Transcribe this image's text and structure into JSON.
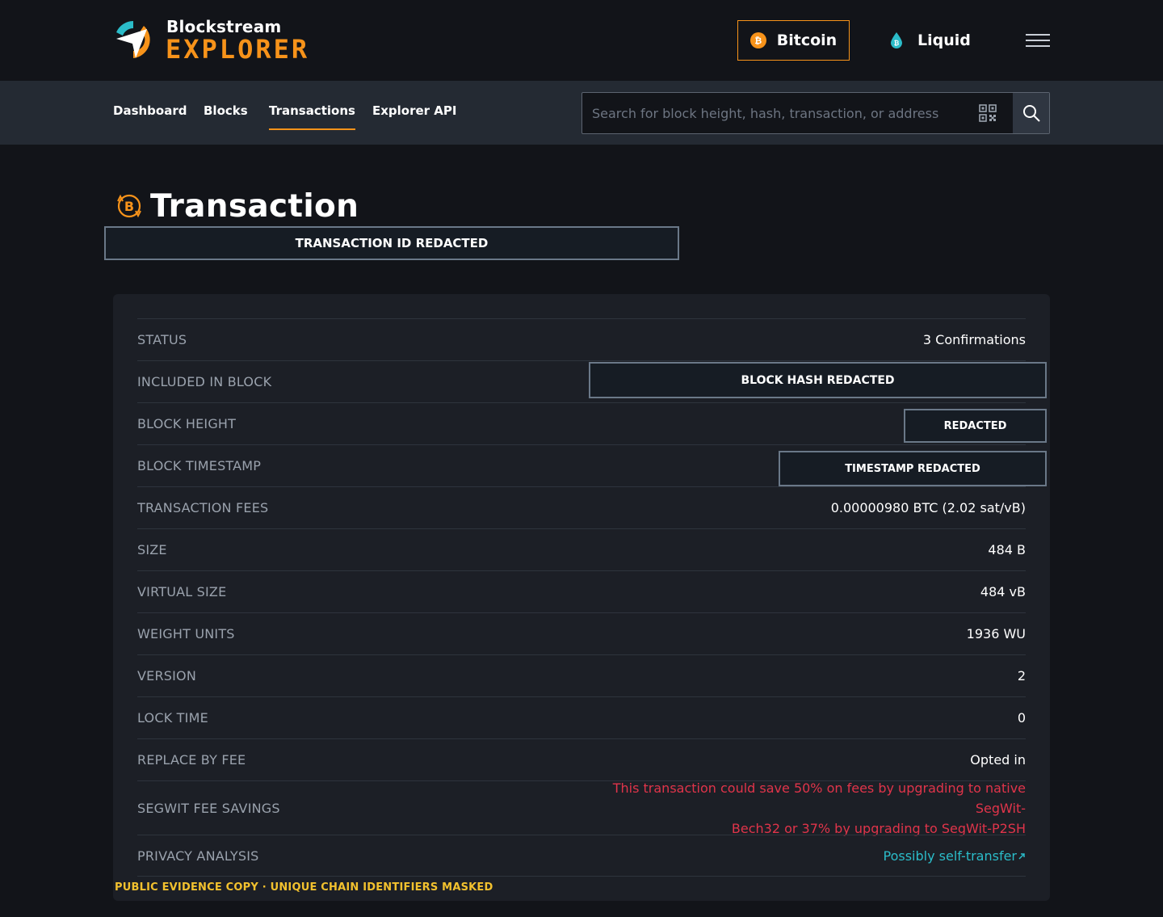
{
  "brand": {
    "top": "Blockstream",
    "bottom": "EXPLORER",
    "accent_color": "#f7931a",
    "icon": "blockstream-explorer-logo"
  },
  "networks": {
    "bitcoin": {
      "label": "Bitcoin",
      "icon": "bitcoin-coin-icon",
      "active": true
    },
    "liquid": {
      "label": "Liquid",
      "icon": "liquid-drop-icon",
      "active": false
    }
  },
  "menu_icon": "hamburger-menu-icon",
  "nav": {
    "items": [
      {
        "label": "Dashboard",
        "active": false
      },
      {
        "label": "Blocks",
        "active": false
      },
      {
        "label": "Transactions",
        "active": true
      },
      {
        "label": "Explorer API",
        "active": false
      }
    ]
  },
  "search": {
    "placeholder": "Search for block height, hash, transaction, or address",
    "value": "",
    "qr_icon": "qr-code-icon",
    "submit_icon": "search-icon"
  },
  "page": {
    "title": "Transaction",
    "title_icon": "bitcoin-transaction-icon",
    "txid_redaction": "TRANSACTION ID REDACTED"
  },
  "details": {
    "status": {
      "label": "STATUS",
      "value": "3 Confirmations"
    },
    "included_in_block": {
      "label": "INCLUDED IN BLOCK",
      "value": "BLOCK HASH REDACTED"
    },
    "block_height": {
      "label": "BLOCK HEIGHT",
      "value": "REDACTED"
    },
    "block_timestamp": {
      "label": "BLOCK TIMESTAMP",
      "value": "TIMESTAMP REDACTED"
    },
    "transaction_fees": {
      "label": "TRANSACTION FEES",
      "value": "0.00000980 BTC (2.02 sat/vB)"
    },
    "size": {
      "label": "SIZE",
      "value": "484 B"
    },
    "virtual_size": {
      "label": "VIRTUAL SIZE",
      "value": "484 vB"
    },
    "weight_units": {
      "label": "WEIGHT UNITS",
      "value": "1936 WU"
    },
    "version": {
      "label": "VERSION",
      "value": "2"
    },
    "lock_time": {
      "label": "LOCK TIME",
      "value": "0"
    },
    "replace_by_fee": {
      "label": "REPLACE BY FEE",
      "value": "Opted in"
    },
    "segwit_fee_savings": {
      "label": "SEGWIT FEE SAVINGS",
      "value_line1": "This transaction could save 50% on fees by upgrading to native SegWit-",
      "value_line2": "Bech32 or 37% by upgrading to SegWit-P2SH",
      "color": "#e0344a"
    },
    "privacy_analysis": {
      "label": "PRIVACY ANALYSIS",
      "value": "Possibly self-transfer",
      "link_icon": "external-link-icon",
      "color": "#2bbcc9"
    }
  },
  "evidence_note": "PUBLIC EVIDENCE COPY · UNIQUE CHAIN IDENTIFIERS MASKED"
}
